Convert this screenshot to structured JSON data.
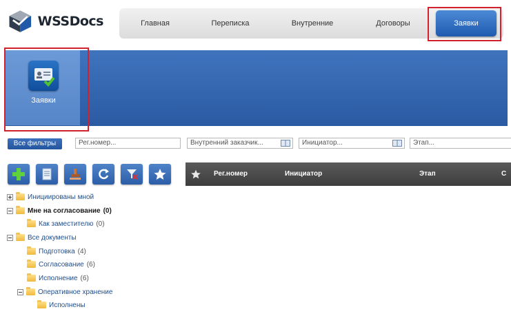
{
  "app": {
    "name": "WSSDocs"
  },
  "topnav": {
    "items": [
      {
        "label": "Главная"
      },
      {
        "label": "Переписка"
      },
      {
        "label": "Внутренние"
      },
      {
        "label": "Договоры"
      },
      {
        "label": "Заявки",
        "active": true
      }
    ]
  },
  "banner": {
    "tile_label": "Заявки"
  },
  "filters": {
    "all_filters_label": "Все фильтры",
    "reg_number_placeholder": "Рег.номер...",
    "internal_customer_placeholder": "Внутренний заказчик...",
    "initiator_placeholder": "Инициатор...",
    "stage_placeholder": "Этап..."
  },
  "toolbar": {
    "buttons": [
      {
        "icon": "plus-icon"
      },
      {
        "icon": "document-icon"
      },
      {
        "icon": "stamp-icon"
      },
      {
        "icon": "refresh-icon"
      },
      {
        "icon": "filter-clear-icon"
      },
      {
        "icon": "star-icon"
      }
    ]
  },
  "grid": {
    "columns": [
      "Рег.номер",
      "Инициатор",
      "Этап",
      "С"
    ]
  },
  "tree": {
    "items": [
      {
        "label": "Инициированы мной",
        "count": ""
      },
      {
        "label": "Мне на согласование",
        "count": "(0)",
        "bold": true
      },
      {
        "label": "Как заместителю",
        "count": "(0)"
      },
      {
        "label": "Все документы",
        "count": ""
      },
      {
        "label": "Подготовка",
        "count": "(4)"
      },
      {
        "label": "Согласование",
        "count": "(6)"
      },
      {
        "label": "Исполнение",
        "count": "(6)"
      },
      {
        "label": "Оперативное хранение",
        "count": ""
      },
      {
        "label": "Исполнены",
        "count": ""
      }
    ]
  },
  "colors": {
    "accent": "#2a5aa2",
    "highlight": "#d2202d",
    "header_dark": "#3d3d3d"
  }
}
